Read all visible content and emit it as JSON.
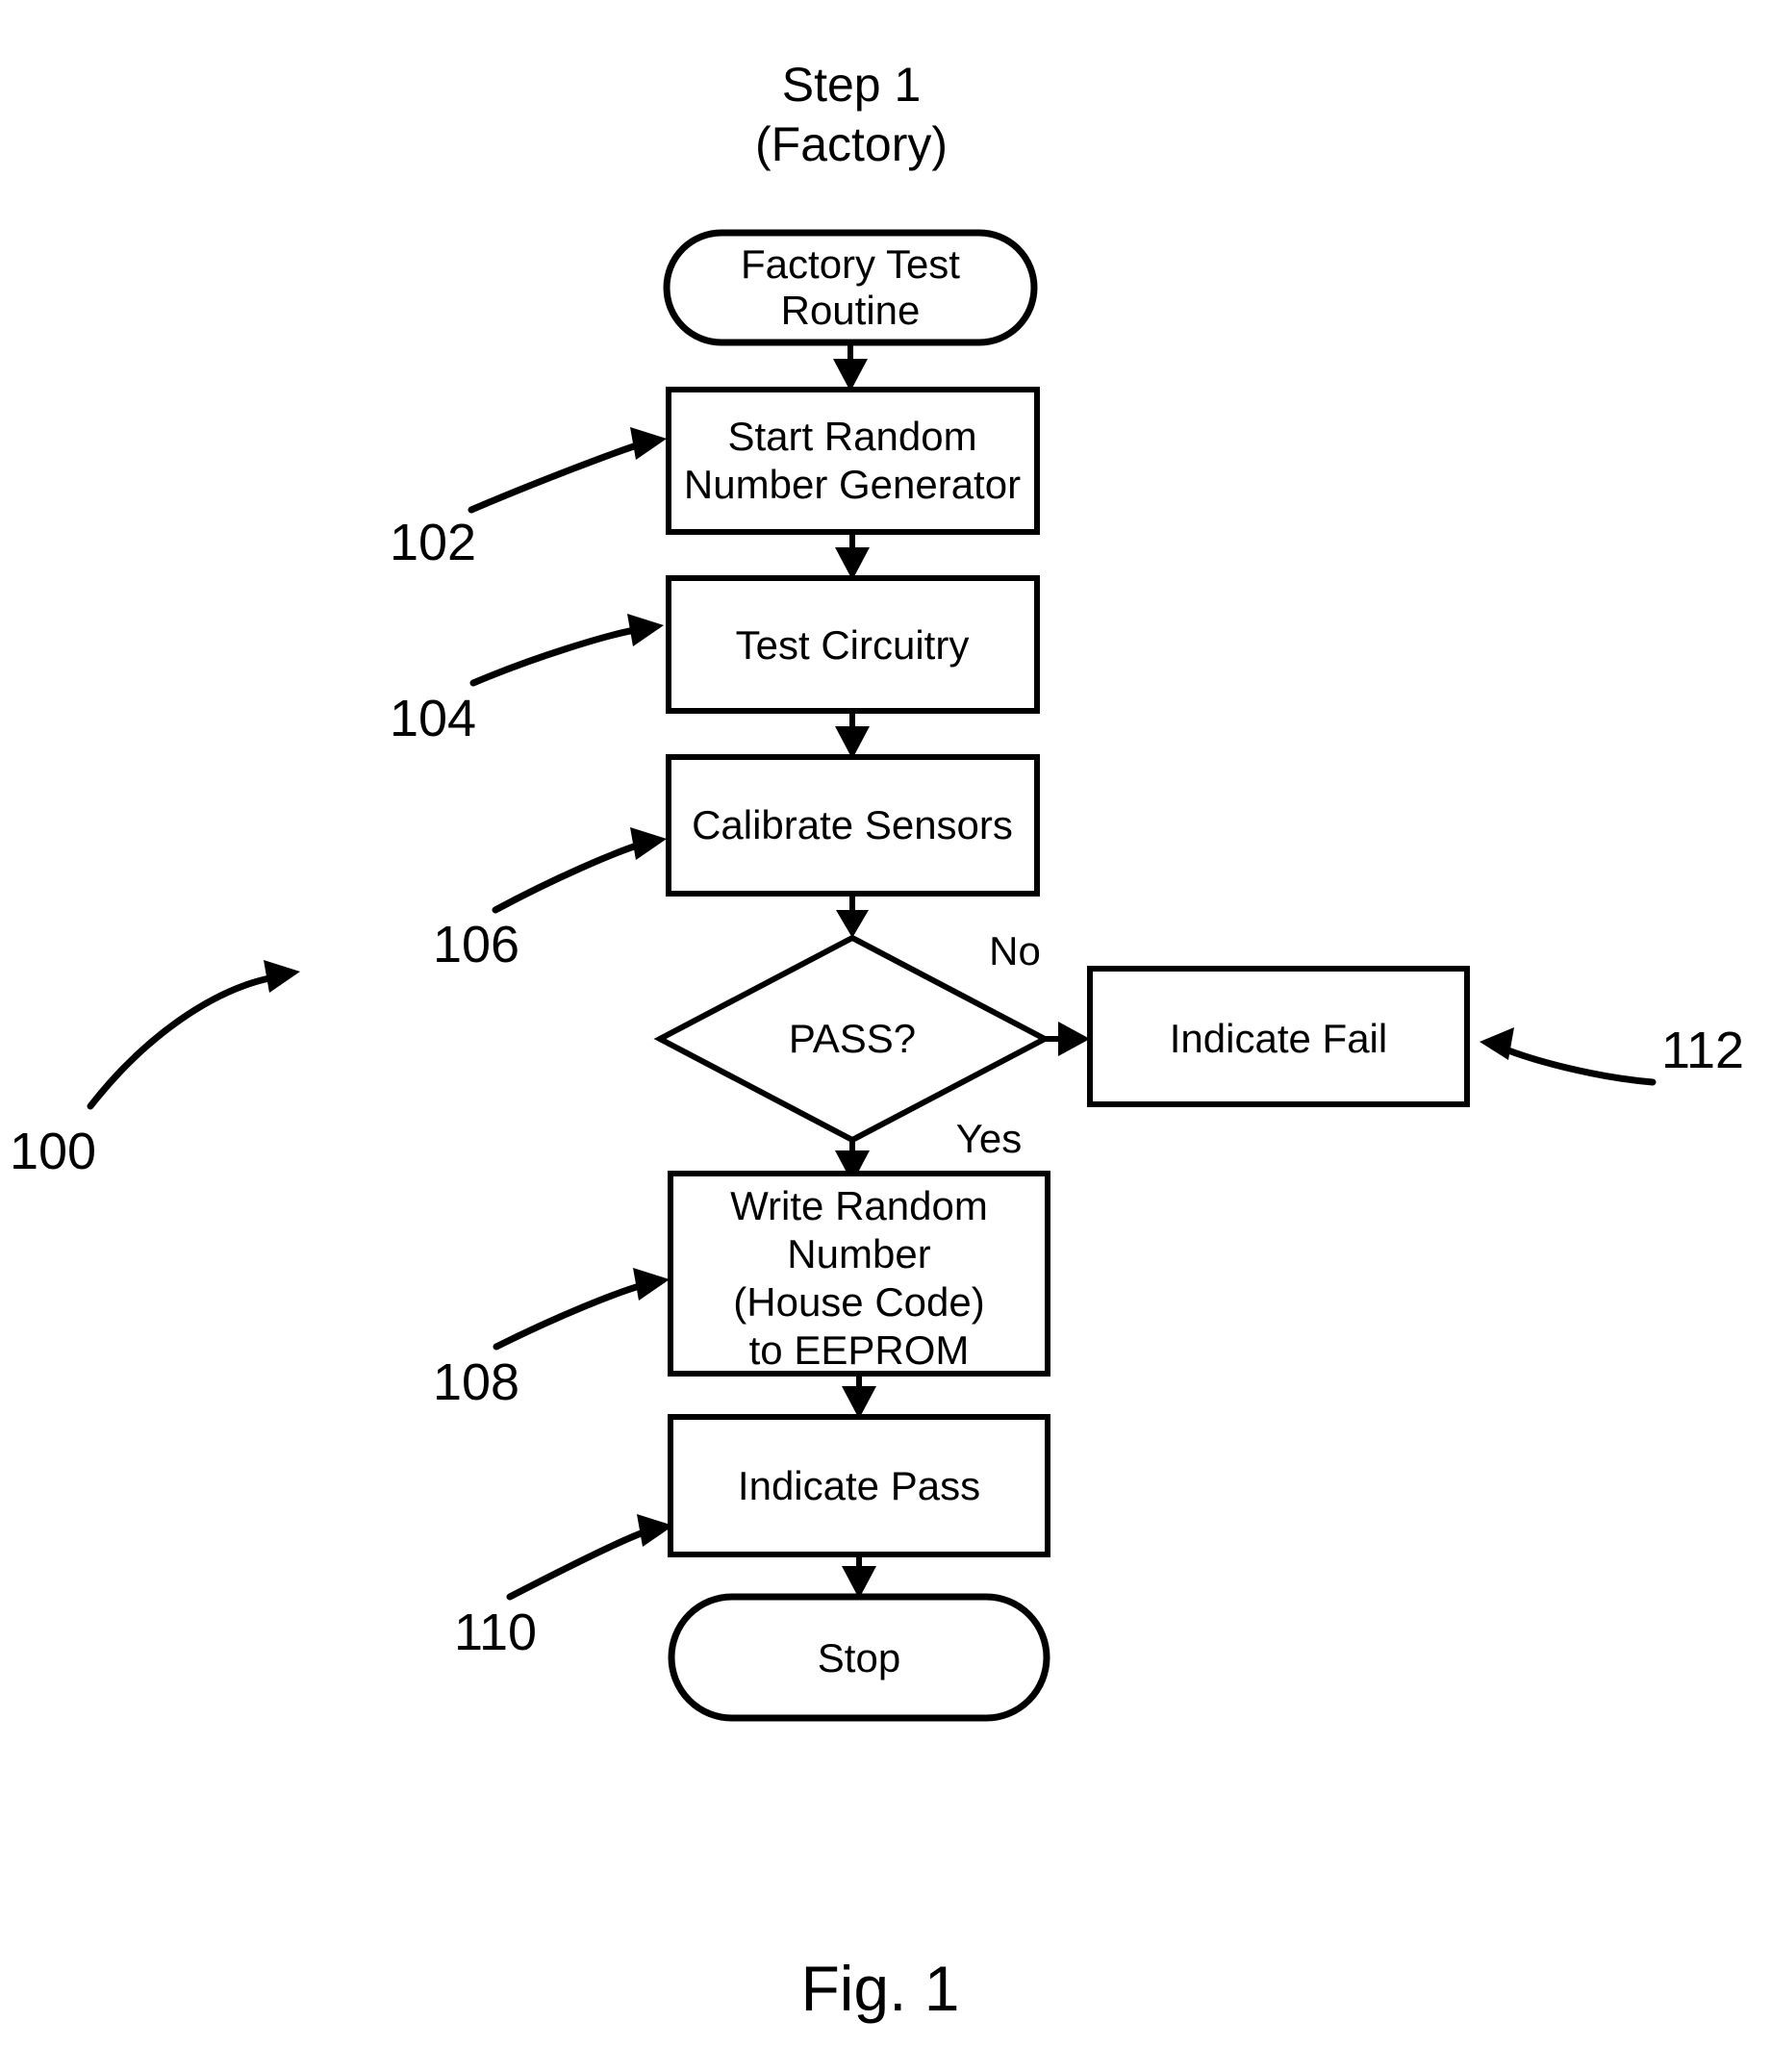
{
  "figure": {
    "title_line1": "Step 1",
    "title_line2": "(Factory)",
    "caption": "Fig. 1"
  },
  "nodes": {
    "start": {
      "label": "Factory Test Routine",
      "line1": "Factory Test",
      "line2": "Routine",
      "shape": "terminal"
    },
    "rng": {
      "label": "Start Random Number Generator",
      "line1": "Start Random",
      "line2": "Number Generator",
      "shape": "process"
    },
    "test": {
      "label": "Test Circuitry",
      "line1": "Test Circuitry",
      "shape": "process"
    },
    "calibrate": {
      "label": "Calibrate Sensors",
      "line1": "Calibrate Sensors",
      "shape": "process"
    },
    "decision": {
      "label": "PASS?",
      "line1": "PASS?",
      "shape": "decision"
    },
    "fail": {
      "label": "Indicate Fail",
      "line1": "Indicate Fail",
      "shape": "process"
    },
    "write": {
      "label": "Write Random Number (House Code) to EEPROM",
      "line1": "Write Random",
      "line2": "Number",
      "line3": "(House Code)",
      "line4": "to EEPROM",
      "shape": "process"
    },
    "pass": {
      "label": "Indicate Pass",
      "line1": "Indicate Pass",
      "shape": "process"
    },
    "stop": {
      "label": "Stop",
      "line1": "Stop",
      "shape": "terminal"
    }
  },
  "branches": {
    "no": "No",
    "yes": "Yes"
  },
  "reference_numerals": {
    "figure": "100",
    "rng": "102",
    "test": "104",
    "calibrate": "106",
    "write": "108",
    "pass": "110",
    "fail": "112"
  },
  "colors": {
    "ink": "#000000",
    "paper": "#ffffff"
  }
}
